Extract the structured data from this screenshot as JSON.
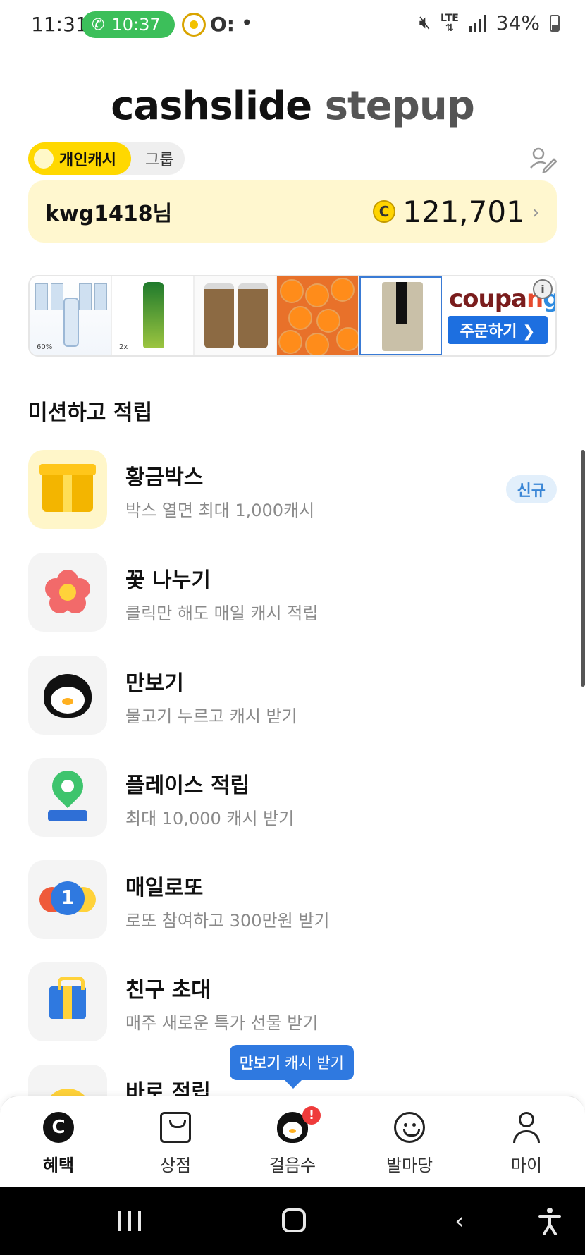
{
  "status_bar": {
    "time": "11:31",
    "call_timer": "10:37",
    "extra_icon": "O:",
    "network": "LTE",
    "battery": "34%"
  },
  "brand": {
    "name_bold": "cashslide",
    "name_light": "stepup"
  },
  "account_toggle": {
    "personal": "개인캐시",
    "group": "그룹"
  },
  "balance": {
    "username": "kwg1418님",
    "coin_symbol": "C",
    "amount": "121,701"
  },
  "ad": {
    "brand": "coupang",
    "button_label": "주문하기 ❯",
    "info_label": "i",
    "thumb_tags": [
      "60%",
      "2x"
    ]
  },
  "missions_section": {
    "title": "미션하고 적립",
    "items": [
      {
        "title": "황금박스",
        "subtitle": "박스 열면 최대 1,000캐시",
        "badge": "신규",
        "icon": "gold-gift-icon"
      },
      {
        "title": "꽃 나누기",
        "subtitle": "클릭만 해도 매일 캐시 적립",
        "icon": "flower-icon"
      },
      {
        "title": "만보기",
        "subtitle": "물고기 누르고 캐시 받기",
        "icon": "penguin-icon"
      },
      {
        "title": "플레이스 적립",
        "subtitle": "최대 10,000 캐시 받기",
        "icon": "map-pin-icon"
      },
      {
        "title": "매일로또",
        "subtitle": "로또 참여하고 300만원 받기",
        "icon": "lotto-balls-icon",
        "ball_number": "1"
      },
      {
        "title": "친구 초대",
        "subtitle": "매주 새로운 특가 선물 받기",
        "icon": "blue-gift-icon"
      },
      {
        "title": "바로 적립",
        "subtitle": "",
        "icon": "coin-icon"
      }
    ]
  },
  "tooltip": {
    "bold": "만보기",
    "rest": "캐시 받기"
  },
  "bottom_nav": [
    {
      "label": "혜택",
      "icon": "cash-c-icon",
      "active": true
    },
    {
      "label": "상점",
      "icon": "shopping-bag-icon"
    },
    {
      "label": "걸음수",
      "icon": "penguin-icon",
      "alert": "!"
    },
    {
      "label": "발마당",
      "icon": "chat-smile-icon"
    },
    {
      "label": "마이",
      "icon": "user-icon"
    }
  ],
  "colors": {
    "accent": "#ffd800",
    "card": "#fff7cf",
    "blue": "#2f79e0",
    "badge_text": "#3a86d6"
  }
}
